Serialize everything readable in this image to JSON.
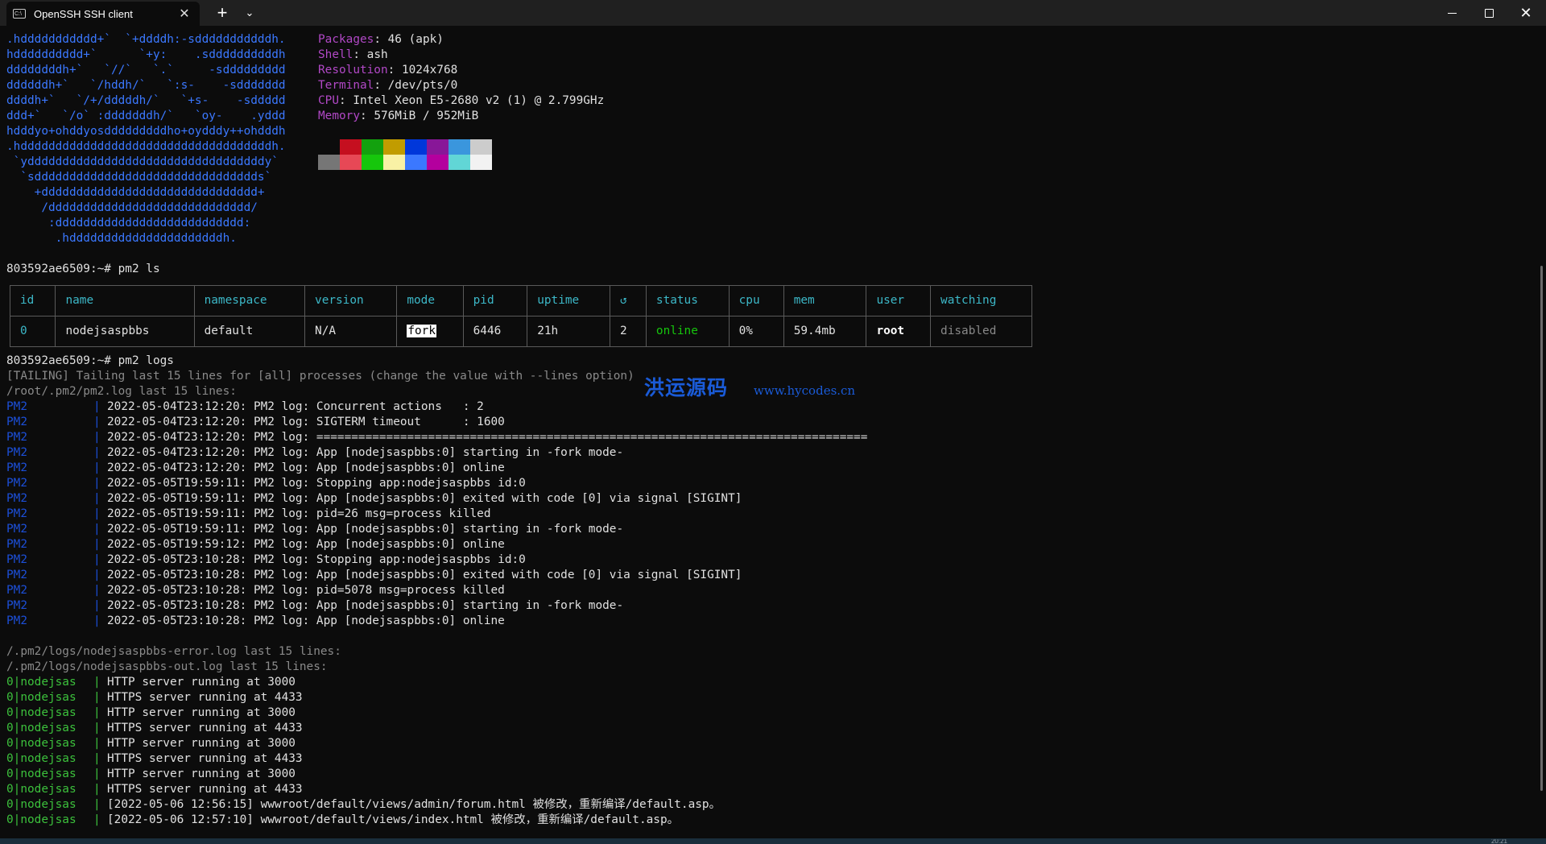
{
  "window": {
    "tab_title": "OpenSSH SSH client",
    "tab_close_glyph": "✕",
    "new_tab_glyph": "+",
    "dropdown_glyph": "⌄",
    "minimize_label": "minimize",
    "maximize_label": "maximize",
    "close_glyph": "✕"
  },
  "logo_lines": [
    ".hddddddddddd+`  `+ddddh:-sdddddddddddh.",
    "hdddddddddd+`      `+y:    .sddddddddddh",
    "ddddddddh+`   `//`   `.`     -sddddddddd",
    "ddddddh+`   `/hddh/`   `:s-    -sddddddd",
    "ddddh+`   `/+/dddddh/`   `+s-    -sddddd",
    "ddd+`   `/o` :dddddddh/`   `oy-    .yddd",
    "hdddyo+ohddyosdddddddddho+oydddy++ohdddh",
    ".hddddddddddddddddddddddddddddddddddddh.",
    " `yddddddddddddddddddddddddddddddddddy`",
    "  `sdddddddddddddddddddddddddddddddds`",
    "    +ddddddddddddddddddddddddddddddd+",
    "     /ddddddddddddddddddddddddddddd/",
    "      :ddddddddddddddddddddddddddd:",
    "       .hddddddddddddddddddddddh."
  ],
  "sysinfo": [
    {
      "key": "Packages",
      "value": "46 (apk)"
    },
    {
      "key": "Shell",
      "value": "ash"
    },
    {
      "key": "Resolution",
      "value": "1024x768"
    },
    {
      "key": "Terminal",
      "value": "/dev/pts/0"
    },
    {
      "key": "CPU",
      "value": "Intel Xeon E5-2680 v2 (1) @ 2.799GHz"
    },
    {
      "key": "Memory",
      "value": "576MiB / 952MiB"
    }
  ],
  "sysinfo_separator": ": ",
  "palette": {
    "row1": [
      "#0c0c0c",
      "#c50f1f",
      "#13a10e",
      "#c19c00",
      "#0037da",
      "#881798",
      "#3a96dd",
      "#cccccc"
    ],
    "row2": [
      "#767676",
      "#e74856",
      "#16c60c",
      "#f9f1a5",
      "#3b78ff",
      "#b4009e",
      "#61d6d6",
      "#f2f2f2"
    ]
  },
  "prompt_ls": "803592ae6509:~# pm2 ls",
  "table": {
    "headers": [
      "id",
      "name",
      "namespace",
      "version",
      "mode",
      "pid",
      "uptime",
      "↺",
      "status",
      "cpu",
      "mem",
      "user",
      "watching"
    ],
    "row": {
      "id": "0",
      "name": "nodejsaspbbs",
      "namespace": "default",
      "version": "N/A",
      "mode": "fork",
      "pid": "6446",
      "uptime": "21h",
      "restarts": "2",
      "status": "online",
      "cpu": "0%",
      "mem": "59.4mb",
      "user": "root",
      "watching": "disabled"
    }
  },
  "prompt_logs": "803592ae6509:~# pm2 logs",
  "tailing": "[TAILING] Tailing last 15 lines for [all] processes (change the value with --lines option)",
  "pm2_log_header": "/root/.pm2/pm2.log last 15 lines:",
  "pm2_prefix": "PM2",
  "bar": "|",
  "pm2_lines": [
    "2022-05-04T23:12:20: PM2 log: Concurrent actions   : 2",
    "2022-05-04T23:12:20: PM2 log: SIGTERM timeout      : 1600",
    "2022-05-04T23:12:20: PM2 log: ===============================================================================",
    "2022-05-04T23:12:20: PM2 log: App [nodejsaspbbs:0] starting in -fork mode-",
    "2022-05-04T23:12:20: PM2 log: App [nodejsaspbbs:0] online",
    "2022-05-05T19:59:11: PM2 log: Stopping app:nodejsaspbbs id:0",
    "2022-05-05T19:59:11: PM2 log: App [nodejsaspbbs:0] exited with code [0] via signal [SIGINT]",
    "2022-05-05T19:59:11: PM2 log: pid=26 msg=process killed",
    "2022-05-05T19:59:11: PM2 log: App [nodejsaspbbs:0] starting in -fork mode-",
    "2022-05-05T19:59:12: PM2 log: App [nodejsaspbbs:0] online",
    "2022-05-05T23:10:28: PM2 log: Stopping app:nodejsaspbbs id:0",
    "2022-05-05T23:10:28: PM2 log: App [nodejsaspbbs:0] exited with code [0] via signal [SIGINT]",
    "2022-05-05T23:10:28: PM2 log: pid=5078 msg=process killed",
    "2022-05-05T23:10:28: PM2 log: App [nodejsaspbbs:0] starting in -fork mode-",
    "2022-05-05T23:10:28: PM2 log: App [nodejsaspbbs:0] online"
  ],
  "error_log_header": "/.pm2/logs/nodejsaspbbs-error.log last 15 lines:",
  "out_log_header": "/.pm2/logs/nodejsaspbbs-out.log last 15 lines:",
  "app_prefix": "0|nodejsas",
  "app_lines": [
    "HTTP server running at 3000",
    "HTTPS server running at 4433",
    "HTTP server running at 3000",
    "HTTPS server running at 4433",
    "HTTP server running at 3000",
    "HTTPS server running at 4433",
    "HTTP server running at 3000",
    "HTTPS server running at 4433",
    "[2022-05-06 12:56:15] wwwroot/default/views/admin/forum.html 被修改，重新编译/default.asp。",
    "[2022-05-06 12:57:10] wwwroot/default/views/index.html 被修改，重新编译/default.asp。"
  ],
  "watermark": {
    "cn": "洪运源码",
    "url": "www.hycodes.cn"
  },
  "clock": "20:21"
}
